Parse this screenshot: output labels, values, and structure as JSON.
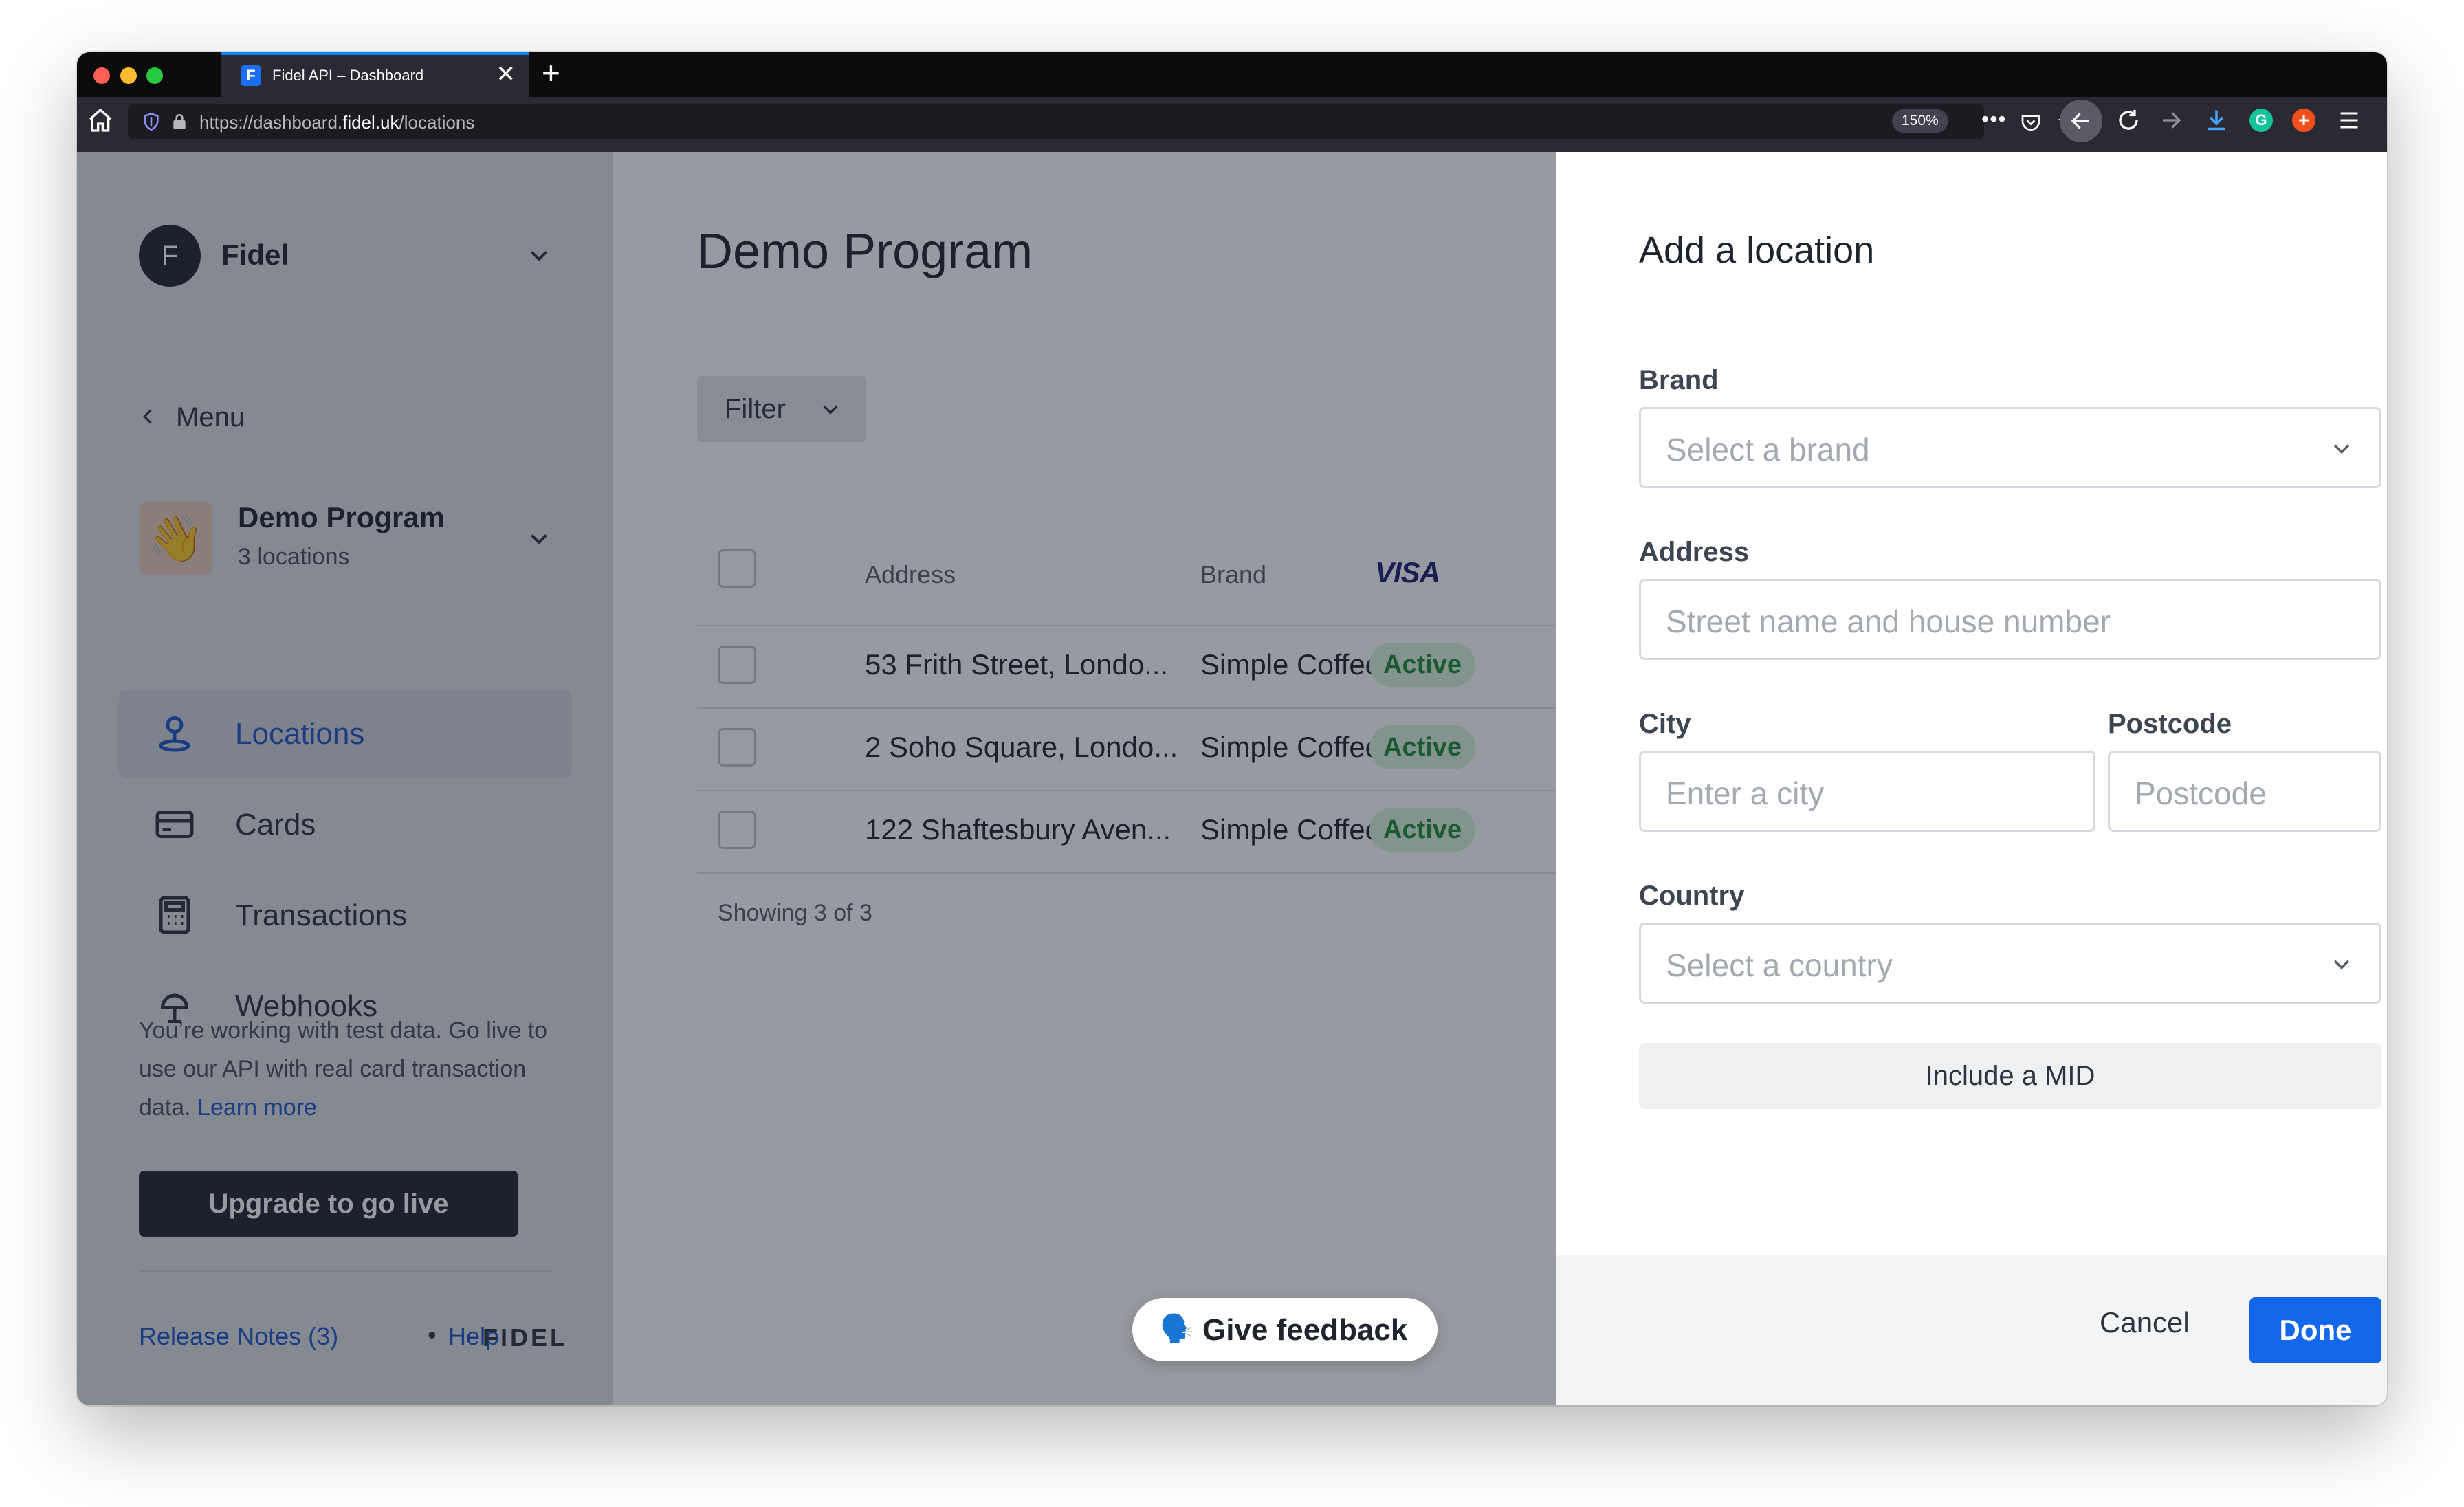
{
  "browser": {
    "tab_title": "Fidel API – Dashboard",
    "tab_close": "✕",
    "new_tab": "+",
    "url_prefix": "https://dashboard.",
    "url_domain": "fidel.uk",
    "url_path": "/locations",
    "zoom": "150%",
    "more": "•••",
    "icons": [
      "home-icon",
      "shield-icon",
      "lock-icon",
      "pocket-icon",
      "star-icon",
      "back-icon",
      "reload-icon",
      "forward-icon",
      "download-icon",
      "grammarly-icon",
      "extension-icon",
      "hamburger-icon"
    ]
  },
  "sidebar": {
    "org_initial": "F",
    "org_name": "Fidel",
    "menu_label": "Menu",
    "program_emoji": "👋",
    "program_name": "Demo Program",
    "program_sub": "3 locations",
    "nav": [
      {
        "label": "Locations",
        "icon": "pin-icon",
        "active": true
      },
      {
        "label": "Cards",
        "icon": "card-icon",
        "active": false
      },
      {
        "label": "Transactions",
        "icon": "calculator-icon",
        "active": false
      },
      {
        "label": "Webhooks",
        "icon": "webhook-icon",
        "active": false
      }
    ],
    "testdata_text": "You’re working with test data. Go live to use our API with real card transaction data.",
    "learn_more": "Learn more",
    "upgrade_label": "Upgrade to go live",
    "release_notes": "Release Notes (3)",
    "separator": "•",
    "help": "Help",
    "logo": "FIDEL"
  },
  "main": {
    "title": "Demo Program",
    "filter_label": "Filter",
    "columns": [
      "Address",
      "Brand",
      "VISA"
    ],
    "rows": [
      {
        "address": "53 Frith Street, Londo...",
        "brand": "Simple Coffee",
        "status": "Active"
      },
      {
        "address": "2 Soho Square, Londo...",
        "brand": "Simple Coffee",
        "status": "Active"
      },
      {
        "address": "122 Shaftesbury Aven...",
        "brand": "Simple Coffee",
        "status": "Active"
      }
    ],
    "showing": "Showing 3 of 3",
    "feedback_emoji": "🗣️",
    "feedback_label": "Give feedback"
  },
  "drawer": {
    "title": "Add a location",
    "brand_label": "Brand",
    "brand_placeholder": "Select a brand",
    "address_label": "Address",
    "address_placeholder": "Street name and house number",
    "city_label": "City",
    "city_placeholder": "Enter a city",
    "postcode_label": "Postcode",
    "postcode_placeholder": "Postcode",
    "country_label": "Country",
    "country_placeholder": "Select a country",
    "mid_label": "Include a MID",
    "cancel_label": "Cancel",
    "done_label": "Done"
  },
  "colors": {
    "accent": "#1467e8",
    "link": "#1a55c9",
    "active_badge_bg": "#dbf3df",
    "active_badge_text": "#1f8a3b",
    "dark": "#1e2530"
  }
}
